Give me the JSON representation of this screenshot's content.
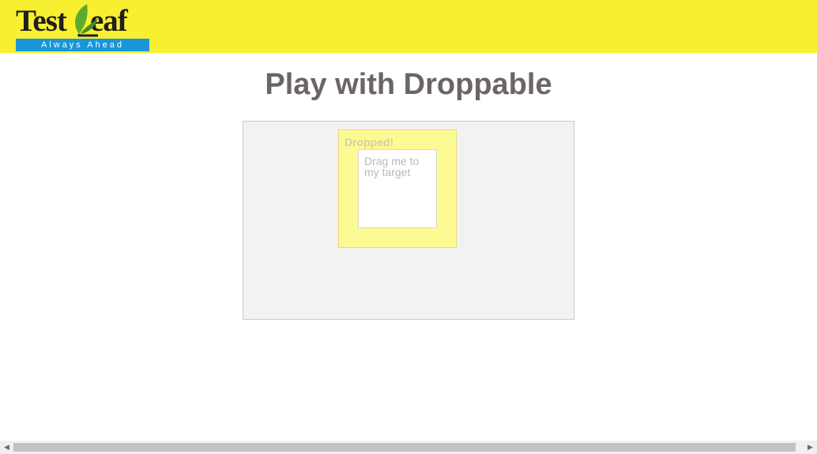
{
  "header": {
    "logo": {
      "name_text": "TestLeaf",
      "tagline": "Always Ahead",
      "colors": {
        "header_bg": "#f8ef30",
        "tagline_bg": "#1995d8",
        "leaf": "#5dab2e"
      }
    }
  },
  "main": {
    "title": "Play with Droppable",
    "droppable": {
      "label": "Dropped!"
    },
    "draggable": {
      "label": "Drag me to my target"
    }
  },
  "scrollbar": {
    "left_icon": "chevron-left-icon",
    "right_icon": "chevron-right-icon"
  }
}
